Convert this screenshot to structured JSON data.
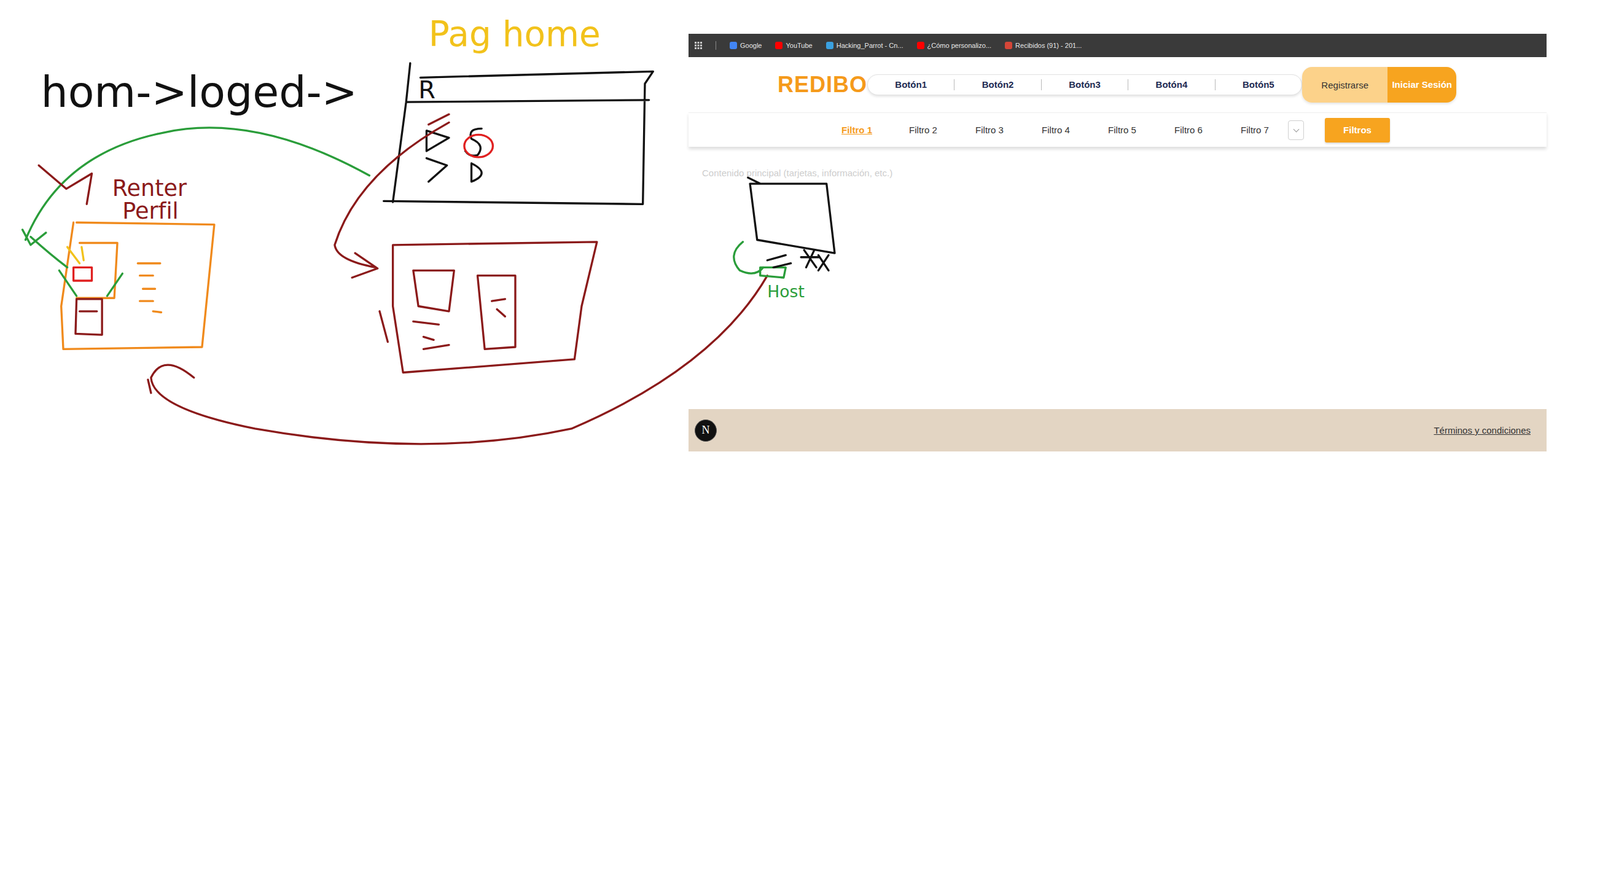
{
  "sketch": {
    "flow_label": "hom->loged->",
    "page_label": "Pag home",
    "wireframe_letter": "R",
    "renter_label_1": "Renter",
    "renter_label_2": "Perfil",
    "host_label": "Host"
  },
  "bookmarks": [
    {
      "label": "Google",
      "color": "#4285f4"
    },
    {
      "label": "YouTube",
      "color": "#ff0000"
    },
    {
      "label": "Hacking_Parrot - Cn...",
      "color": "#3aa0e0"
    },
    {
      "label": "¿Cómo personalizo...",
      "color": "#ff0000"
    },
    {
      "label": "Recibidos (91) - 201...",
      "color": "#d44638"
    }
  ],
  "site": {
    "logo": "REDIBO",
    "nav": [
      "Botón1",
      "Botón2",
      "Botón3",
      "Botón4",
      "Botón5"
    ],
    "register": "Registrarse",
    "login": "Iniciar Sesión"
  },
  "filters": [
    {
      "label": "Filtro 1",
      "selected": true
    },
    {
      "label": "Filtro 2",
      "selected": false
    },
    {
      "label": "Filtro 3",
      "selected": false
    },
    {
      "label": "Filtro 4",
      "selected": false
    },
    {
      "label": "Filtro 5",
      "selected": false
    },
    {
      "label": "Filtro 6",
      "selected": false
    },
    {
      "label": "Filtro 7",
      "selected": false
    }
  ],
  "filters_button": "Filtros",
  "content_placeholder": "Contenido principal (tarjetas, información, etc.)",
  "footer": {
    "badge": "N",
    "link": "Términos y condiciones"
  }
}
